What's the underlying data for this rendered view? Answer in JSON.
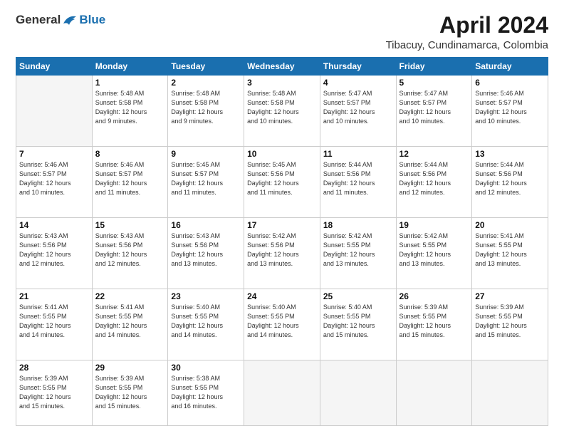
{
  "header": {
    "logo_general": "General",
    "logo_blue": "Blue",
    "title": "April 2024",
    "subtitle": "Tibacuy, Cundinamarca, Colombia"
  },
  "weekdays": [
    "Sunday",
    "Monday",
    "Tuesday",
    "Wednesday",
    "Thursday",
    "Friday",
    "Saturday"
  ],
  "weeks": [
    [
      {
        "day": "",
        "text": ""
      },
      {
        "day": "1",
        "text": "Sunrise: 5:48 AM\nSunset: 5:58 PM\nDaylight: 12 hours\nand 9 minutes."
      },
      {
        "day": "2",
        "text": "Sunrise: 5:48 AM\nSunset: 5:58 PM\nDaylight: 12 hours\nand 9 minutes."
      },
      {
        "day": "3",
        "text": "Sunrise: 5:48 AM\nSunset: 5:58 PM\nDaylight: 12 hours\nand 10 minutes."
      },
      {
        "day": "4",
        "text": "Sunrise: 5:47 AM\nSunset: 5:57 PM\nDaylight: 12 hours\nand 10 minutes."
      },
      {
        "day": "5",
        "text": "Sunrise: 5:47 AM\nSunset: 5:57 PM\nDaylight: 12 hours\nand 10 minutes."
      },
      {
        "day": "6",
        "text": "Sunrise: 5:46 AM\nSunset: 5:57 PM\nDaylight: 12 hours\nand 10 minutes."
      }
    ],
    [
      {
        "day": "7",
        "text": "Sunrise: 5:46 AM\nSunset: 5:57 PM\nDaylight: 12 hours\nand 10 minutes."
      },
      {
        "day": "8",
        "text": "Sunrise: 5:46 AM\nSunset: 5:57 PM\nDaylight: 12 hours\nand 11 minutes."
      },
      {
        "day": "9",
        "text": "Sunrise: 5:45 AM\nSunset: 5:57 PM\nDaylight: 12 hours\nand 11 minutes."
      },
      {
        "day": "10",
        "text": "Sunrise: 5:45 AM\nSunset: 5:56 PM\nDaylight: 12 hours\nand 11 minutes."
      },
      {
        "day": "11",
        "text": "Sunrise: 5:44 AM\nSunset: 5:56 PM\nDaylight: 12 hours\nand 11 minutes."
      },
      {
        "day": "12",
        "text": "Sunrise: 5:44 AM\nSunset: 5:56 PM\nDaylight: 12 hours\nand 12 minutes."
      },
      {
        "day": "13",
        "text": "Sunrise: 5:44 AM\nSunset: 5:56 PM\nDaylight: 12 hours\nand 12 minutes."
      }
    ],
    [
      {
        "day": "14",
        "text": "Sunrise: 5:43 AM\nSunset: 5:56 PM\nDaylight: 12 hours\nand 12 minutes."
      },
      {
        "day": "15",
        "text": "Sunrise: 5:43 AM\nSunset: 5:56 PM\nDaylight: 12 hours\nand 12 minutes."
      },
      {
        "day": "16",
        "text": "Sunrise: 5:43 AM\nSunset: 5:56 PM\nDaylight: 12 hours\nand 13 minutes."
      },
      {
        "day": "17",
        "text": "Sunrise: 5:42 AM\nSunset: 5:56 PM\nDaylight: 12 hours\nand 13 minutes."
      },
      {
        "day": "18",
        "text": "Sunrise: 5:42 AM\nSunset: 5:55 PM\nDaylight: 12 hours\nand 13 minutes."
      },
      {
        "day": "19",
        "text": "Sunrise: 5:42 AM\nSunset: 5:55 PM\nDaylight: 12 hours\nand 13 minutes."
      },
      {
        "day": "20",
        "text": "Sunrise: 5:41 AM\nSunset: 5:55 PM\nDaylight: 12 hours\nand 13 minutes."
      }
    ],
    [
      {
        "day": "21",
        "text": "Sunrise: 5:41 AM\nSunset: 5:55 PM\nDaylight: 12 hours\nand 14 minutes."
      },
      {
        "day": "22",
        "text": "Sunrise: 5:41 AM\nSunset: 5:55 PM\nDaylight: 12 hours\nand 14 minutes."
      },
      {
        "day": "23",
        "text": "Sunrise: 5:40 AM\nSunset: 5:55 PM\nDaylight: 12 hours\nand 14 minutes."
      },
      {
        "day": "24",
        "text": "Sunrise: 5:40 AM\nSunset: 5:55 PM\nDaylight: 12 hours\nand 14 minutes."
      },
      {
        "day": "25",
        "text": "Sunrise: 5:40 AM\nSunset: 5:55 PM\nDaylight: 12 hours\nand 15 minutes."
      },
      {
        "day": "26",
        "text": "Sunrise: 5:39 AM\nSunset: 5:55 PM\nDaylight: 12 hours\nand 15 minutes."
      },
      {
        "day": "27",
        "text": "Sunrise: 5:39 AM\nSunset: 5:55 PM\nDaylight: 12 hours\nand 15 minutes."
      }
    ],
    [
      {
        "day": "28",
        "text": "Sunrise: 5:39 AM\nSunset: 5:55 PM\nDaylight: 12 hours\nand 15 minutes."
      },
      {
        "day": "29",
        "text": "Sunrise: 5:39 AM\nSunset: 5:55 PM\nDaylight: 12 hours\nand 15 minutes."
      },
      {
        "day": "30",
        "text": "Sunrise: 5:38 AM\nSunset: 5:55 PM\nDaylight: 12 hours\nand 16 minutes."
      },
      {
        "day": "",
        "text": ""
      },
      {
        "day": "",
        "text": ""
      },
      {
        "day": "",
        "text": ""
      },
      {
        "day": "",
        "text": ""
      }
    ]
  ]
}
